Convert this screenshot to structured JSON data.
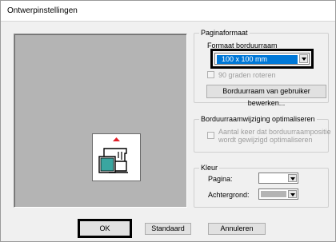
{
  "window": {
    "title": "Ontwerpinstellingen"
  },
  "page_format": {
    "legend": "Paginaformaat",
    "sublabel": "Formaat borduurraam",
    "size_value": "100 x 100 mm",
    "rotate_label": "90 graden roteren",
    "edit_button": "Borduurraam van gebruiker bewerken..."
  },
  "optimize": {
    "legend": "Borduurraamwijziging optimaliseren",
    "option_label_line1": "Aantal keer dat borduurraampositie",
    "option_label_line2": "wordt gewijzigd optimaliseren"
  },
  "color": {
    "legend": "Kleur",
    "page_label": "Pagina:",
    "page_value_color": "#ffffff",
    "background_label": "Achtergrond:",
    "background_value_color": "#b4b4b4"
  },
  "buttons": {
    "ok": "OK",
    "standard": "Standaard",
    "cancel": "Annuleren"
  },
  "colors": {
    "accent": "#0078d7",
    "preview_bg": "#b4b4b4",
    "arrow_red": "#e0202a",
    "machine_teal": "#3aa6a0"
  },
  "icons": {
    "preview": "embroidery-machine-icon",
    "rotate_indicator": "up-arrow-icon"
  }
}
